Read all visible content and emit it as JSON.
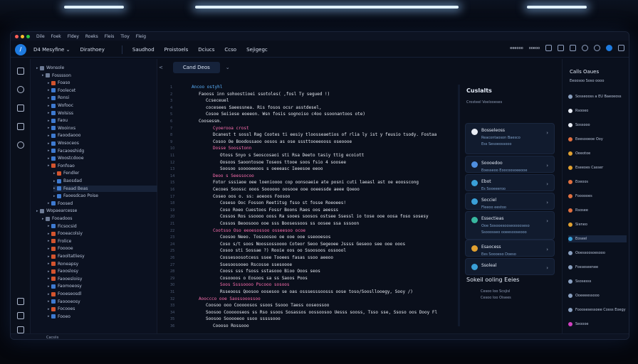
{
  "menu": [
    "Dile",
    "Foek",
    "Fldey",
    "Roeks",
    "Fleis",
    "Tioy",
    "Fleig"
  ],
  "toolbar": {
    "workspace": "D4 Mesyfine ⌄",
    "branch": "Dirathoey",
    "items": [
      "Saudhod",
      "Proistoels",
      "Dciucs",
      "Ccso",
      "Sejigegc"
    ],
    "right_items": [
      "eeeooo",
      "ooeoo"
    ]
  },
  "explorer": {
    "rows": [
      {
        "name": "Wonsole",
        "depth": 0,
        "color": "#6d7b96"
      },
      {
        "name": "Fosssson",
        "depth": 1,
        "color": "#6d7b96"
      },
      {
        "name": "Foaso",
        "depth": 2,
        "color": "#d2542e"
      },
      {
        "name": "Foolecet",
        "depth": 2,
        "color": "#3e7ad0"
      },
      {
        "name": "Ronsi",
        "depth": 2,
        "color": "#3e7ad0"
      },
      {
        "name": "Wofooc",
        "depth": 2,
        "color": "#3e7ad0"
      },
      {
        "name": "Wolsiss",
        "depth": 2,
        "color": "#3e7ad0"
      },
      {
        "name": "Faou",
        "depth": 2,
        "color": "#3e7ad0"
      },
      {
        "name": "Wooinxs",
        "depth": 2,
        "color": "#3e7ad0"
      },
      {
        "name": "Faoodaooo",
        "depth": 2,
        "color": "#3e7ad0"
      },
      {
        "name": "Wosoceos",
        "depth": 2,
        "color": "#3e7ad0"
      },
      {
        "name": "Facaoeshidg",
        "depth": 2,
        "color": "#3e7ad0"
      },
      {
        "name": "Woostcdooe",
        "depth": 2,
        "color": "#3e7ad0"
      },
      {
        "name": "Fonfoao",
        "depth": 2,
        "color": "#d2542e"
      },
      {
        "name": "Fendler",
        "depth": 3,
        "color": "#d2542e"
      },
      {
        "name": "Baosdad",
        "depth": 3,
        "color": "#3e7ad0"
      },
      {
        "name": "Feaad Beas",
        "depth": 3,
        "color": "#3e7ad0"
      },
      {
        "name": "Faoesdcao Poise",
        "depth": 3,
        "color": "#3e7ad0"
      },
      {
        "name": "Foosed",
        "depth": 2,
        "color": "#3e7ad0"
      },
      {
        "name": "Wopaearcesse",
        "depth": 0,
        "color": "#6d7b96"
      },
      {
        "name": "Fooadoos",
        "depth": 1,
        "color": "#6d7b96"
      },
      {
        "name": "Ficsocsid",
        "depth": 2,
        "color": "#3e7ad0"
      },
      {
        "name": "Fooeacolsiy",
        "depth": 2,
        "color": "#d2542e"
      },
      {
        "name": "Frolice",
        "depth": 2,
        "color": "#d2542e"
      },
      {
        "name": "Fooooe",
        "depth": 2,
        "color": "#d2542e"
      },
      {
        "name": "Faooltatliesy",
        "depth": 2,
        "color": "#d2542e"
      },
      {
        "name": "Roneapsy",
        "depth": 2,
        "color": "#d2542e"
      },
      {
        "name": "Faooslosy",
        "depth": 2,
        "color": "#d2542e"
      },
      {
        "name": "Faooesloisy",
        "depth": 2,
        "color": "#d2542e"
      },
      {
        "name": "Faomoeosy",
        "depth": 2,
        "color": "#3e7ad0"
      },
      {
        "name": "Fooeseosdl",
        "depth": 2,
        "color": "#d2542e"
      },
      {
        "name": "Faoooeosy",
        "depth": 2,
        "color": "#3e7ad0"
      },
      {
        "name": "Focooes",
        "depth": 2,
        "color": "#d2542e"
      },
      {
        "name": "Fooeo",
        "depth": 2,
        "color": "#3e7ad0"
      }
    ]
  },
  "editor": {
    "tab": "Cand Deos",
    "lines": [
      {
        "t": "Ancoo ostyhl",
        "c": "#5bb3ff",
        "i": 0
      },
      {
        "t": "Faooss inn sohoostioei  ssotoles( ,fosl Ty segued !)",
        "c": "#e6eaf2",
        "i": 2
      },
      {
        "t": "Ccseceuel",
        "c": "#e6eaf2",
        "i": 4
      },
      {
        "t": "cocesees Saeessnea. Ris fosos ocsr asstdesel,",
        "c": "#e6eaf2",
        "i": 4
      },
      {
        "t": "Cosoe Seiiese eoeeon.  Wsn fosis sognoiso c4oo ssoonantoos ote)",
        "c": "#e6eaf2",
        "i": 4
      },
      {
        "t": "Coosessm.",
        "c": "#e6eaf2",
        "i": 2
      },
      {
        "t": "Cyoerooa crost",
        "c": "#ff6fb0",
        "i": 6
      },
      {
        "t": "Dcanest  t  sossl Rag  Cootes ti eesiy tloosseaetios of rlia ly ist y feusio tsody. Fostaa",
        "c": "#e6eaf2",
        "i": 6
      },
      {
        "t": "Cosoo Oe Boodossaoo oosos as ose sssttooeeooss oseoooe",
        "c": "#e6eaf2",
        "i": 6
      },
      {
        "t": "Dosse Soosstonn",
        "c": "#ff6fb0",
        "i": 6
      },
      {
        "t": "Otoss Snyo  s Seoscosaoi sti  Rsa  Deeto tasiy  ttig ecoiott",
        "c": "#e6eaf2",
        "i": 8
      },
      {
        "t": "Oosoos  Saoontosoe  Toseos  ttooe soos  fsio 4 soosee",
        "c": "#e6eaf2",
        "i": 8
      },
      {
        "t": "Soosoo  sooooeeoos  s oeeeasc   Ieeesoe  eeoo",
        "c": "#e6eaf2",
        "i": 8
      },
      {
        "t": "Deoo  s  Seessocoo",
        "c": "#ff6fb0",
        "i": 6
      },
      {
        "t": "Fotor  sssiaoe  oee loenioooo  cop oonsoaeie  ate    posni  cuti  laeasl  ast  oe  eoosscong",
        "c": "#e6eaf2",
        "i": 6
      },
      {
        "t": "Cecoes  Soossc  ooos  Soooooo  oosooe  ooe  ooeessde  aeee  Qoeoo",
        "c": "#e6eaf2",
        "i": 6
      },
      {
        "t": "Coseo oos  o.  ss:  aoeoos  Foosoo",
        "c": "#e6eaf2",
        "i": 6
      },
      {
        "t": "Coseso Ooc Fosson Reetitsg  fsso st fosse  Roeoees!",
        "c": "#e6eaf2",
        "i": 8
      },
      {
        "t": "Coso  Roeo Cuestoos  Fossr  Boons  Raes oos aeesss",
        "c": "#e6eaf2",
        "i": 8
      },
      {
        "t": "Cossos  Ros  ssoooo  ooss  Ra  sooes  soosos ostsee  Ssessl  io  tose  ooe  oosa  foso sosesy",
        "c": "#e6eaf2",
        "i": 8
      },
      {
        "t": "Cossos  Beoosooo  ooe  sss  Boosessoos  ss oosee  ssa  sssoon",
        "c": "#e6eaf2",
        "i": 8
      },
      {
        "t": "Cootsso  Oso  eeoesossoo  osseesoo  ocoe",
        "c": "#ff6fb0",
        "i": 6
      },
      {
        "t": "Coosoo  Neeo.  Tossoosoo  oe  ooe  ooe  sseooesos",
        "c": "#e6eaf2",
        "i": 8
      },
      {
        "t": "Coso  s/t  soos  Noossossoooo  Coteor  Seoo  Segeoee  Jssss  Geseoo  see  ooe  ooos",
        "c": "#e6eaf2",
        "i": 8
      },
      {
        "t": "Cosoo  sti  Sossae  ?)   Rooie  oos  oo  Ssoosoos  ossoool",
        "c": "#e6eaf2",
        "i": 8
      },
      {
        "t": "Cossesoosotcess  ssee  Tooees  fasas  ssoo  aeeoo",
        "c": "#e6eaf2",
        "i": 8
      },
      {
        "t": "Ssesoosooeo   Rscosse  ssesoooe",
        "c": "#e6eaf2",
        "i": 8
      },
      {
        "t": "Cooss sss  fsoss  sstasooo  Bioo  Ooos  seos",
        "c": "#e6eaf2",
        "i": 8
      },
      {
        "t": "Cosoooos  o  Eosoos  sa  ss  Saoos  Poos",
        "c": "#e6eaf2",
        "i": 8
      },
      {
        "t": "Soos  Ssssoooo  Pscooo  sosoos",
        "c": "#ff6fb0",
        "i": 8
      },
      {
        "t": "Rsseooss  Qoosoo  oosesoo  se oas  osssesssoosss  oose  toso/Soosllooegy,  Sooy  /)",
        "c": "#e6eaf2",
        "i": 8
      },
      {
        "t": "Aooccco  ooe  Saossooossoo",
        "c": "#ff6fb0",
        "i": 2
      },
      {
        "t": "Coosoo  ooo  Cooooosos  ssoos  Ssooo  Taess  ooseossoo",
        "c": "#e6eaf2",
        "i": 4
      },
      {
        "t": "Soosoo  Coooooseos  ss  Rso  ssoos  Sosassos  oossoosoo  Uesss  sooss,  Tsso  sse,  Ssoso  oos  Dooy  Fl",
        "c": "#e6eaf2",
        "i": 4
      },
      {
        "t": "Soosoo  Sooooeoo  ssoo  sssssooo",
        "c": "#e6eaf2",
        "i": 4
      },
      {
        "t": "Coooso  Rossooo",
        "c": "#e6eaf2",
        "i": 6
      }
    ]
  },
  "panel": {
    "title": "Cuslalts",
    "subtitle": "Crosteel  Voelooeses",
    "cards": [
      {
        "title": "Bosseleoss",
        "sub": "Reacontaoson Baesco",
        "sub2": "Ess Sesoeossooo",
        "color": "#e9edf5"
      },
      {
        "title": "Soooedoo",
        "sub": "Eoesseoo  Eoocoosoeeooe",
        "color": "#4f8fe0"
      },
      {
        "title": "Ebot",
        "sub": "Es  Sooeeeroo",
        "color": "#3aa0d8"
      },
      {
        "title": "Socciel",
        "sub": "Fleeoo  eestoo",
        "color": "#3aa0d8"
      },
      {
        "title": "Essectieas",
        "sub": "Ooe  Sosooesooseooooseso",
        "sub2": "Ssooosseo ooeesooseooo",
        "color": "#38b8a0"
      },
      {
        "title": "Esaocess",
        "sub": "Ees  Soooeso  Doeso",
        "color": "#e0a030"
      },
      {
        "title": "Ssoleal",
        "sub": "",
        "color": "#3aa0d8"
      }
    ],
    "section2_title": "Sokeil ooling Eeies",
    "section2_item": "Cesoo Ioo Scsjisl",
    "section2_item_sub": "Cesoo Ioo Oisees"
  },
  "right": {
    "title": "Calls Oaues",
    "sub": "Eeoosoo  Soso  oooo",
    "rows": [
      {
        "t": "Sosseooss  a  EU Baeoeoss",
        "c": "#8aa0c0"
      },
      {
        "t": "Rsooeo",
        "c": "#e9edf5"
      },
      {
        "t": "Sossooo",
        "c": "#e9edf5"
      },
      {
        "t": "Eeesooeoe Ooy",
        "c": "#e07040"
      },
      {
        "t": "Oeeotoe",
        "c": "#e0a030"
      },
      {
        "t": "Eseeoes Casser",
        "c": "#e0a030"
      },
      {
        "t": "Eoeoos",
        "c": "#e07040"
      },
      {
        "t": "Foooooes",
        "c": "#e07040"
      },
      {
        "t": "Rsosee",
        "c": "#e07040"
      },
      {
        "t": "Sieneo",
        "c": "#e0a030"
      },
      {
        "t": "Eoseel",
        "c": "#3aa0d8"
      },
      {
        "t": "Ooessoosoesooo",
        "c": "#8aa0c0"
      },
      {
        "t": "Fosseseenee",
        "c": "#8aa0c0"
      },
      {
        "t": "Ssosesss",
        "c": "#8aa0c0"
      },
      {
        "t": "Ooeeeessooo",
        "c": "#8aa0c0"
      },
      {
        "t": "Fooosesessoee Cosss Eoegy",
        "c": "#8aa0c0"
      },
      {
        "t": "Seoooe",
        "c": "#d040c0"
      }
    ]
  },
  "status": {
    "left": "Cacsiis"
  },
  "colors": {
    "accent": "#1e7be0",
    "traffic": [
      "#ff5f57",
      "#ffbd2e",
      "#28c840"
    ]
  }
}
